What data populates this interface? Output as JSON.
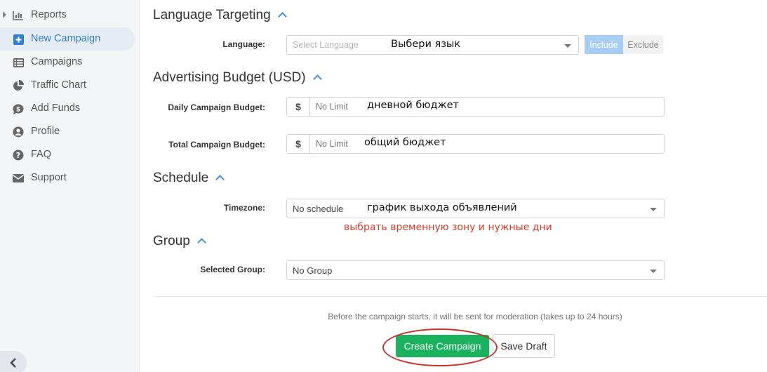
{
  "sidebar": {
    "items": [
      {
        "label": "Reports",
        "icon": "bar-chart-icon"
      },
      {
        "label": "New Campaign",
        "icon": "plus-square-icon"
      },
      {
        "label": "Campaigns",
        "icon": "list-icon"
      },
      {
        "label": "Traffic Chart",
        "icon": "pie-chart-icon"
      },
      {
        "label": "Add Funds",
        "icon": "dollar-bubble-icon"
      },
      {
        "label": "Profile",
        "icon": "user-icon"
      },
      {
        "label": "FAQ",
        "icon": "question-icon"
      },
      {
        "label": "Support",
        "icon": "envelope-icon"
      }
    ],
    "active_index": 1,
    "accent_color": "#2f7fd1"
  },
  "language_section": {
    "title": "Language Targeting",
    "label": "Language:",
    "placeholder": "Select Language",
    "include_label": "Include",
    "exclude_label": "Exclude",
    "annotation": "Выбери язык"
  },
  "budget_section": {
    "title": "Advertising Budget (USD)",
    "daily_label": "Daily Campaign Budget:",
    "daily_placeholder": "No Limit",
    "daily_annotation": "дневной бюджет",
    "total_label": "Total Campaign Budget:",
    "total_placeholder": "No Limit",
    "total_annotation": "общий бюджет",
    "currency_symbol": "$"
  },
  "schedule_section": {
    "title": "Schedule",
    "label": "Timezone:",
    "value": "No schedule",
    "annotation": "график выхода объявлений",
    "red_annotation": "выбрать временную зону и нужные дни"
  },
  "group_section": {
    "title": "Group",
    "label": "Selected Group:",
    "value": "No Group"
  },
  "footer": {
    "note": "Before the campaign starts, it will be sent for moderation (takes up to 24 hours)",
    "create_label": "Create Campaign",
    "save_label": "Save Draft",
    "create_color": "#1ab15f",
    "highlight_color": "#c8342a"
  }
}
